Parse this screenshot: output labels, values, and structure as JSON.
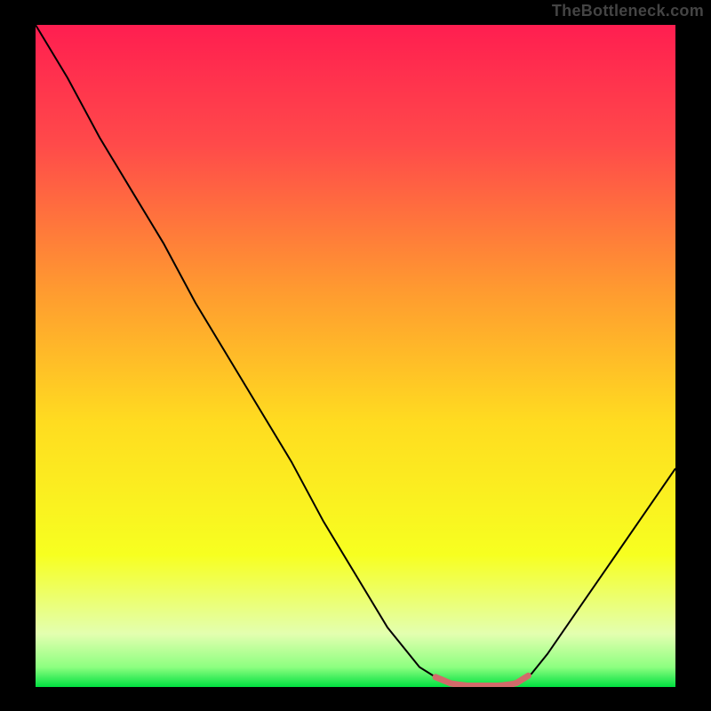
{
  "watermark": "TheBottleneck.com",
  "chart_data": {
    "type": "line",
    "title": "",
    "xlabel": "",
    "ylabel": "",
    "x": [
      0.0,
      0.05,
      0.1,
      0.15,
      0.2,
      0.25,
      0.3,
      0.35,
      0.4,
      0.45,
      0.5,
      0.55,
      0.6,
      0.625,
      0.65,
      0.675,
      0.7,
      0.725,
      0.75,
      0.775,
      0.8,
      0.85,
      0.9,
      0.95,
      1.0
    ],
    "y": [
      1.0,
      0.92,
      0.83,
      0.75,
      0.67,
      0.58,
      0.5,
      0.42,
      0.34,
      0.25,
      0.17,
      0.09,
      0.03,
      0.015,
      0.005,
      0.002,
      0.002,
      0.002,
      0.005,
      0.02,
      0.05,
      0.12,
      0.19,
      0.26,
      0.33
    ],
    "xlim": [
      0,
      1
    ],
    "ylim": [
      0,
      1
    ],
    "highlight": {
      "x_start": 0.625,
      "x_end": 0.77
    },
    "background_gradient": {
      "stops": [
        {
          "offset": 0.0,
          "hex": "#ff1e50"
        },
        {
          "offset": 0.18,
          "hex": "#ff4a4a"
        },
        {
          "offset": 0.4,
          "hex": "#ff9a30"
        },
        {
          "offset": 0.6,
          "hex": "#ffdc20"
        },
        {
          "offset": 0.8,
          "hex": "#f7ff20"
        },
        {
          "offset": 0.92,
          "hex": "#e3ffb0"
        },
        {
          "offset": 0.97,
          "hex": "#8dff80"
        },
        {
          "offset": 1.0,
          "hex": "#00e040"
        }
      ]
    },
    "curve_color": "#000000",
    "highlight_color": "#d26a6a"
  }
}
